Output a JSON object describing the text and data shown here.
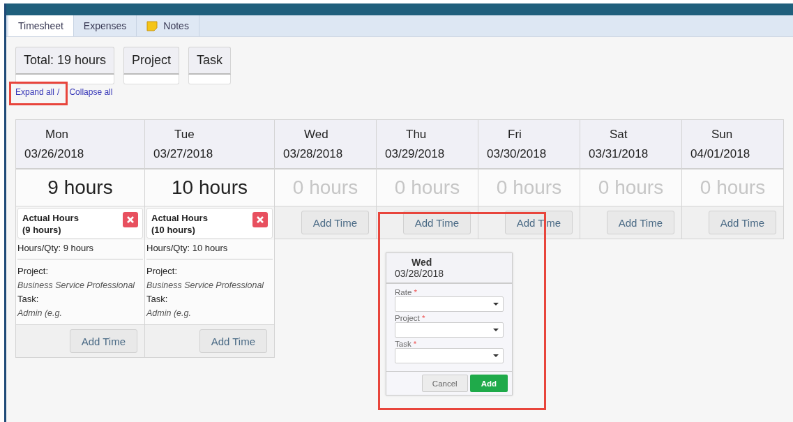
{
  "tabs": [
    {
      "label": "Timesheet",
      "selected": true,
      "kind": "text"
    },
    {
      "label": "Expenses",
      "selected": false,
      "kind": "text"
    },
    {
      "label": "Notes",
      "selected": false,
      "kind": "note"
    }
  ],
  "summary": [
    {
      "label": "Total: 19 hours"
    },
    {
      "label": "Project"
    },
    {
      "label": "Task"
    }
  ],
  "links": {
    "expand": "Expand all",
    "separator": "/",
    "collapse": "Collapse all",
    "highlighted": true
  },
  "days": [
    {
      "day": "Mon",
      "date": "03/26/2018",
      "hours": "9 hours",
      "has_time": true,
      "add": "Add Time",
      "entries": [
        {
          "title": "Actual Hours",
          "subtitle": "(9 hours)",
          "qty": "Hours/Qty: 9 hours",
          "project_label": "Project:",
          "project": "Business Service Professional",
          "task_label": "Task:",
          "task": "Admin (e.g."
        }
      ]
    },
    {
      "day": "Tue",
      "date": "03/27/2018",
      "hours": "10 hours",
      "has_time": true,
      "add": "Add Time",
      "entries": [
        {
          "title": "Actual Hours",
          "subtitle": "(10 hours)",
          "qty": "Hours/Qty: 10 hours",
          "project_label": "Project:",
          "project": "Business Service Professional",
          "task_label": "Task:",
          "task": "Admin (e.g."
        }
      ]
    },
    {
      "day": "Wed",
      "date": "03/28/2018",
      "hours": "0 hours",
      "has_time": false,
      "add": "Add Time"
    },
    {
      "day": "Thu",
      "date": "03/29/2018",
      "hours": "0 hours",
      "has_time": false,
      "add": "Add Time"
    },
    {
      "day": "Fri",
      "date": "03/30/2018",
      "hours": "0 hours",
      "has_time": false,
      "add": "Add Time"
    },
    {
      "day": "Sat",
      "date": "03/31/2018",
      "hours": "0 hours",
      "has_time": false,
      "add": "Add Time"
    },
    {
      "day": "Sun",
      "date": "04/01/2018",
      "hours": "0 hours",
      "has_time": false,
      "add": "Add Time"
    }
  ],
  "popup": {
    "day": "Wed",
    "date": "03/28/2018",
    "highlighted": true,
    "fields": [
      {
        "label": "Rate",
        "mark": "*"
      },
      {
        "label": "Project",
        "mark": "*"
      },
      {
        "label": "Task",
        "mark": "*"
      }
    ],
    "cancel": "Cancel",
    "submit": "Add"
  }
}
